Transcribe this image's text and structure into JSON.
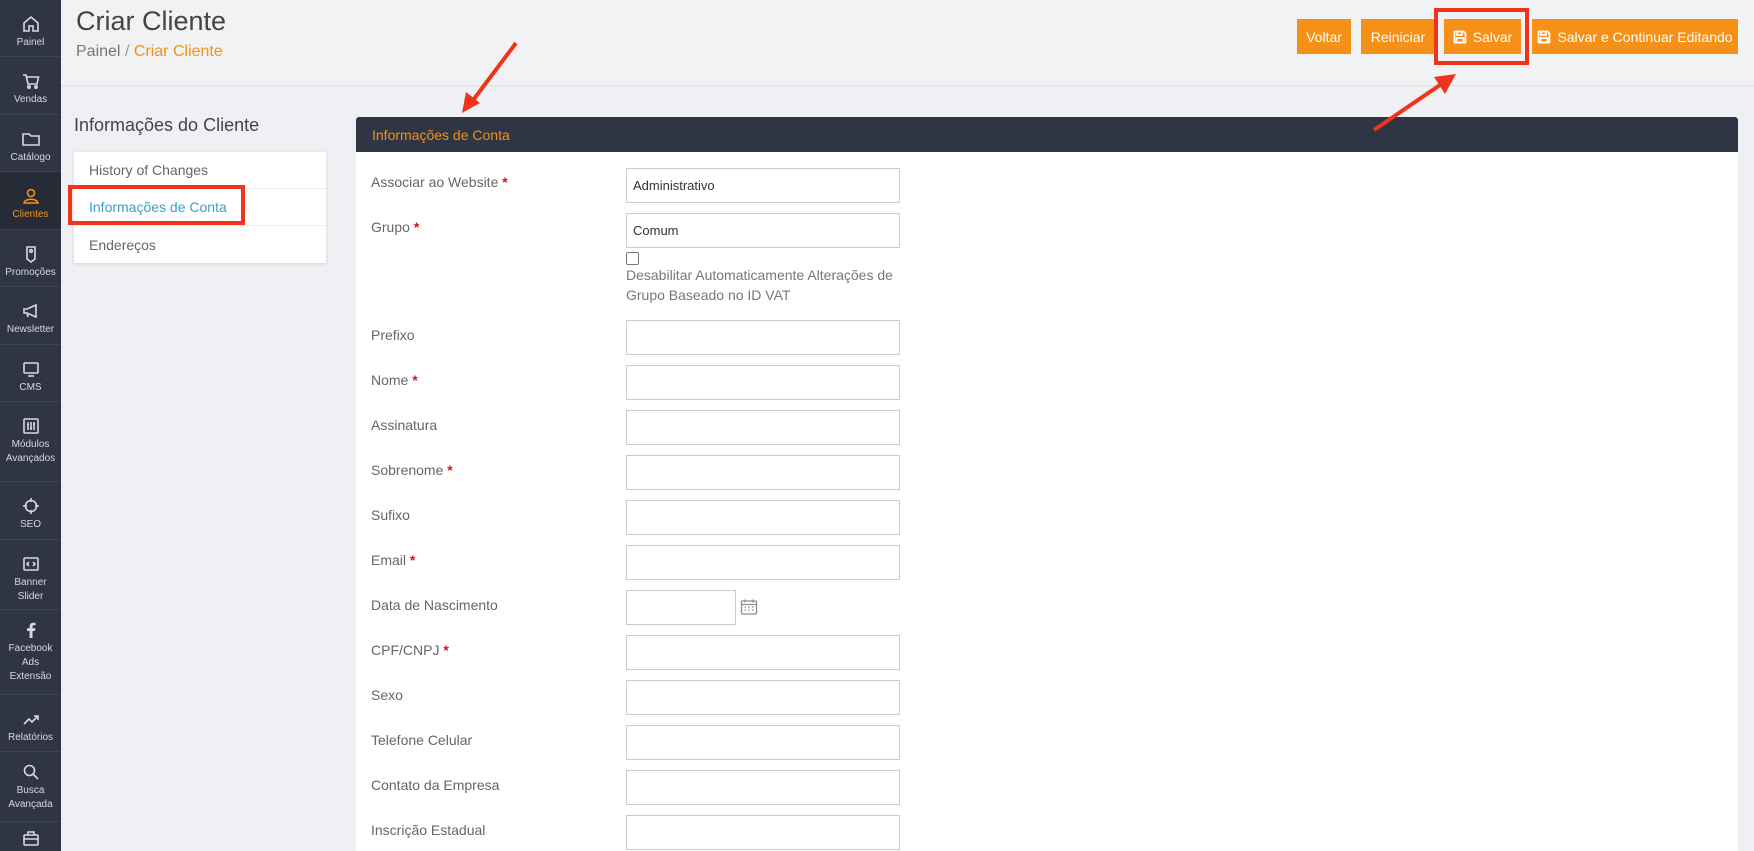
{
  "sidebar": {
    "items": [
      {
        "label": "Painel",
        "icon": "home-icon"
      },
      {
        "label": "Vendas",
        "icon": "cart-icon"
      },
      {
        "label": "Catálogo",
        "icon": "folder-icon"
      },
      {
        "label": "Clientes",
        "icon": "user-icon",
        "active": true
      },
      {
        "label": "Promoções",
        "icon": "tag-icon"
      },
      {
        "label": "Newsletter",
        "icon": "megaphone-icon"
      },
      {
        "label": "CMS",
        "icon": "monitor-icon"
      },
      {
        "label": "Módulos Avançados",
        "icon": "sliders-icon"
      },
      {
        "label": "SEO",
        "icon": "target-icon"
      },
      {
        "label": "Banner Slider",
        "icon": "code-icon"
      },
      {
        "label": "Facebook Ads Extensão",
        "icon": "facebook-icon"
      },
      {
        "label": "Relatórios",
        "icon": "chart-icon"
      },
      {
        "label": "Busca Avançada",
        "icon": "search-icon"
      },
      {
        "label": "",
        "icon": "briefcase-icon"
      }
    ]
  },
  "header": {
    "title": "Criar Cliente",
    "breadcrumb_root": "Painel",
    "breadcrumb_separator": "/",
    "breadcrumb_current": "Criar Cliente",
    "buttons": {
      "back": "Voltar",
      "reset": "Reiniciar",
      "save": "Salvar",
      "save_continue": "Salvar e Continuar Editando"
    }
  },
  "subnav": {
    "title": "Informações do Cliente",
    "items": [
      "History of Changes",
      "Informações de Conta",
      "Endereços"
    ]
  },
  "panel": {
    "title": "Informações de Conta",
    "fields": {
      "website": {
        "label": "Associar ao Website",
        "value": "Administrativo"
      },
      "group": {
        "label": "Grupo",
        "value": "Comum"
      },
      "disable_vat": {
        "label": "Desabilitar Automaticamente Alterações de Grupo Baseado no ID VAT"
      },
      "prefix": {
        "label": "Prefixo"
      },
      "first_name": {
        "label": "Nome"
      },
      "middle_name": {
        "label": "Assinatura"
      },
      "last_name": {
        "label": "Sobrenome"
      },
      "suffix": {
        "label": "Sufixo"
      },
      "email": {
        "label": "Email"
      },
      "dob": {
        "label": "Data de Nascimento"
      },
      "cpf": {
        "label": "CPF/CNPJ"
      },
      "gender": {
        "label": "Sexo"
      },
      "mobile": {
        "label": "Telefone Celular"
      },
      "company_contact": {
        "label": "Contato da Empresa"
      },
      "state_registration": {
        "label": "Inscrição Estadual"
      }
    },
    "required_marker": "*"
  },
  "colors": {
    "accent": "#f79016",
    "sidebar_bg": "#2f3542",
    "annotation": "#f0341c",
    "link": "#3aa0c9"
  }
}
